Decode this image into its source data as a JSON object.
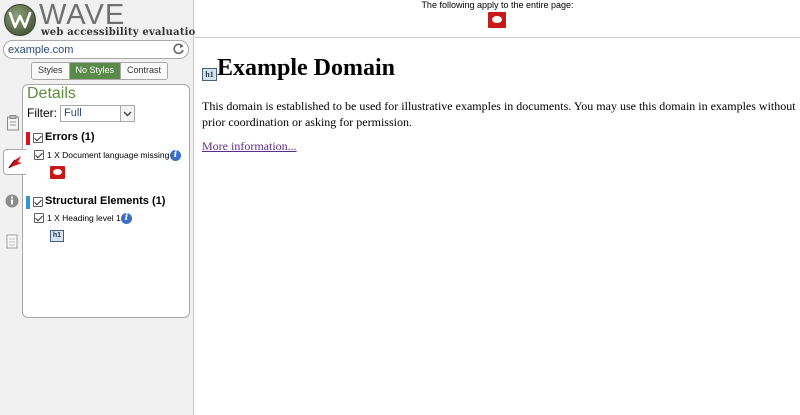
{
  "brand": {
    "name": "WAVE",
    "tagline": "web accessibility evaluation tool"
  },
  "url_bar": {
    "value": "example.com"
  },
  "view_toggle": {
    "styles": "Styles",
    "no_styles": "No Styles",
    "contrast": "Contrast",
    "active": "No Styles"
  },
  "details": {
    "title": "Details",
    "filter_label": "Filter:",
    "filter_value": "Full",
    "categories": [
      {
        "title": "Errors (1)",
        "color": "#d9151b",
        "items": [
          {
            "text": "1 X Document language missing",
            "icon": "error-speech-bubble"
          }
        ]
      },
      {
        "title": "Structural Elements (1)",
        "color": "#2f97d9",
        "items": [
          {
            "text": "1 X Heading level 1",
            "icon": "h1-badge",
            "badge_text": "h1"
          }
        ]
      }
    ]
  },
  "banner": {
    "text": "The following apply to the entire page:",
    "icon": "error-speech-bubble"
  },
  "page": {
    "heading_badge": "h1",
    "heading": "Example Domain",
    "paragraph": "This domain is established to be used for illustrative examples in documents. You may use this domain in examples without prior coordination or asking for permission.",
    "link_text": "More information..."
  },
  "colors": {
    "brand_green": "#5e8e3e",
    "active_toggle": "#5b8a4a",
    "error_red": "#c8191a",
    "structure_blue": "#2f97d9",
    "link_visited": "#5f2c8a"
  }
}
